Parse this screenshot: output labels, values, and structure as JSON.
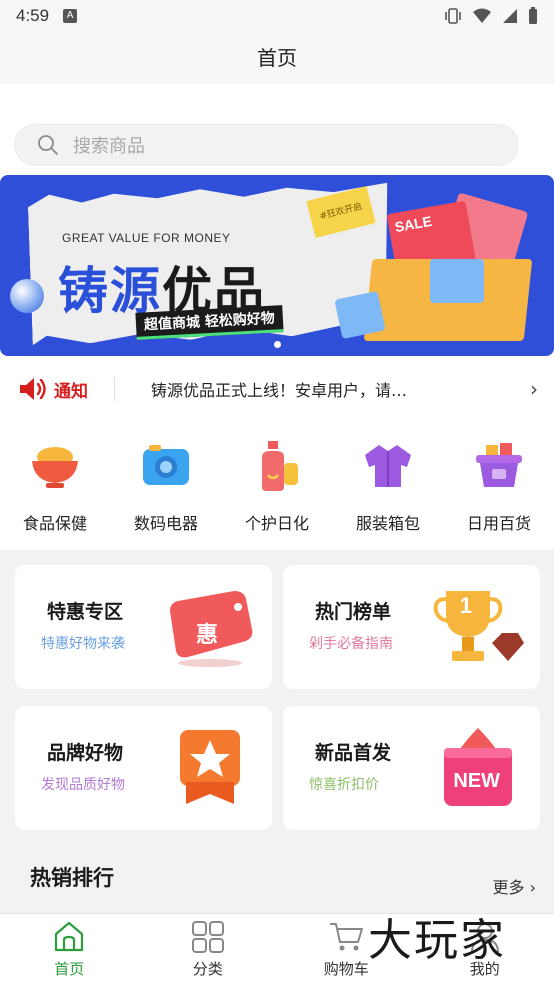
{
  "status_bar": {
    "time": "4:59",
    "badge": "A"
  },
  "title_bar": {
    "title": "首页"
  },
  "search": {
    "placeholder": "搜索商品"
  },
  "banner": {
    "kicker": "GREAT VALUE FOR MONEY",
    "title_part1": "铸源",
    "title_part2": "优品",
    "tagline": "超值商城  轻松购好物",
    "sticker": "#狂欢开启",
    "sale_tag": "SALE"
  },
  "notice": {
    "label": "通知",
    "text": "铸源优品正式上线！安卓用户，请…"
  },
  "categories": [
    {
      "label": "食品保健",
      "icon": "food-bowl-icon"
    },
    {
      "label": "数码电器",
      "icon": "camera-icon"
    },
    {
      "label": "个护日化",
      "icon": "lotion-bottle-icon"
    },
    {
      "label": "服装箱包",
      "icon": "jacket-icon"
    },
    {
      "label": "日用百货",
      "icon": "basket-icon"
    }
  ],
  "promos": [
    {
      "title": "特惠专区",
      "subtitle": "特惠好物来袭",
      "subtitle_color": "#6aa0e0",
      "badge": "惠"
    },
    {
      "title": "热门榜单",
      "subtitle": "剁手必备指南",
      "subtitle_color": "#e07aa0",
      "badge": "1"
    },
    {
      "title": "品牌好物",
      "subtitle": "发现品质好物",
      "subtitle_color": "#b47ad6",
      "badge": ""
    },
    {
      "title": "新品首发",
      "subtitle": "惊喜折扣价",
      "subtitle_color": "#8cc06a",
      "badge": "NEW"
    }
  ],
  "hot": {
    "title": "热销排行",
    "more": "更多"
  },
  "tabbar": [
    {
      "label": "首页",
      "icon": "home-icon",
      "active": true
    },
    {
      "label": "分类",
      "icon": "grid-icon",
      "active": false
    },
    {
      "label": "购物车",
      "icon": "cart-icon",
      "active": false
    },
    {
      "label": "我的",
      "icon": "user-icon",
      "active": false
    }
  ],
  "watermark": "大玩家",
  "colors": {
    "accent": "#2a9d3c",
    "notice_red": "#d61f1f",
    "banner_blue": "#2f4fd8"
  }
}
